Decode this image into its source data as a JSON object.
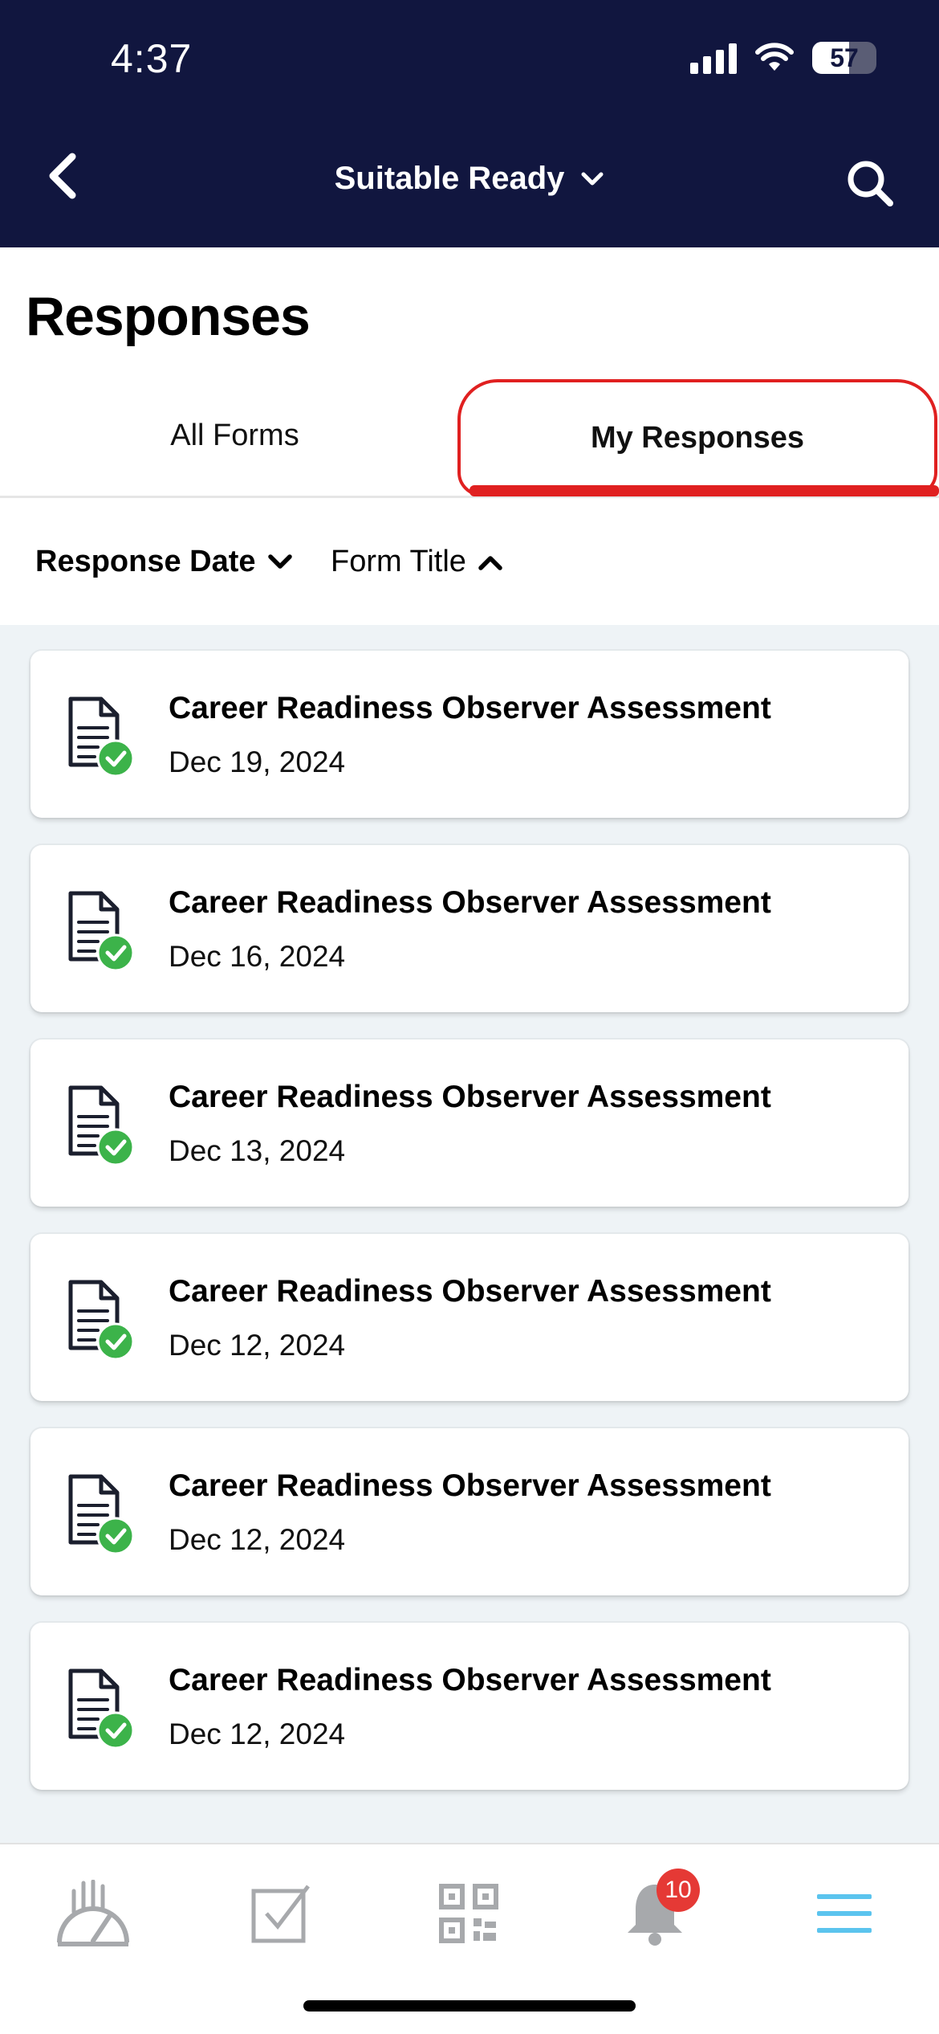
{
  "status_bar": {
    "time": "4:37",
    "battery": "57",
    "battery_level_percent": 57
  },
  "header": {
    "title": "Suitable Ready",
    "back_icon": "chevron-left-icon",
    "dropdown_icon": "chevron-down-icon",
    "search_icon": "search-icon"
  },
  "page": {
    "title": "Responses"
  },
  "tabs": [
    {
      "label": "All Forms",
      "selected": false
    },
    {
      "label": "My Responses",
      "selected": true
    }
  ],
  "sort": {
    "date_label": "Response Date",
    "date_icon": "chevron-down-icon",
    "title_label": "Form Title",
    "title_icon": "chevron-up-icon"
  },
  "responses": [
    {
      "title": "Career Readiness Observer Assessment",
      "date": "Dec 19, 2024",
      "icon": "document-check-icon"
    },
    {
      "title": "Career Readiness Observer Assessment",
      "date": "Dec 16, 2024",
      "icon": "document-check-icon"
    },
    {
      "title": "Career Readiness Observer Assessment",
      "date": "Dec 13, 2024",
      "icon": "document-check-icon"
    },
    {
      "title": "Career Readiness Observer Assessment",
      "date": "Dec 12, 2024",
      "icon": "document-check-icon"
    },
    {
      "title": "Career Readiness Observer Assessment",
      "date": "Dec 12, 2024",
      "icon": "document-check-icon"
    },
    {
      "title": "Career Readiness Observer Assessment",
      "date": "Dec 12, 2024",
      "icon": "document-check-icon"
    }
  ],
  "bottom_nav": {
    "items": [
      {
        "icon": "dashboard-gauge-icon"
      },
      {
        "icon": "checkbox-icon"
      },
      {
        "icon": "qr-code-icon"
      },
      {
        "icon": "bell-icon",
        "badge": "10"
      },
      {
        "icon": "menu-icon",
        "active": true
      }
    ]
  },
  "colors": {
    "header_bg": "#11163f",
    "highlight_red": "#e02020",
    "check_green": "#3cb34a",
    "badge_red": "#e53935",
    "menu_active": "#5bc4ee",
    "nav_inactive": "#a7a9ac",
    "list_bg": "#eef3f6"
  }
}
